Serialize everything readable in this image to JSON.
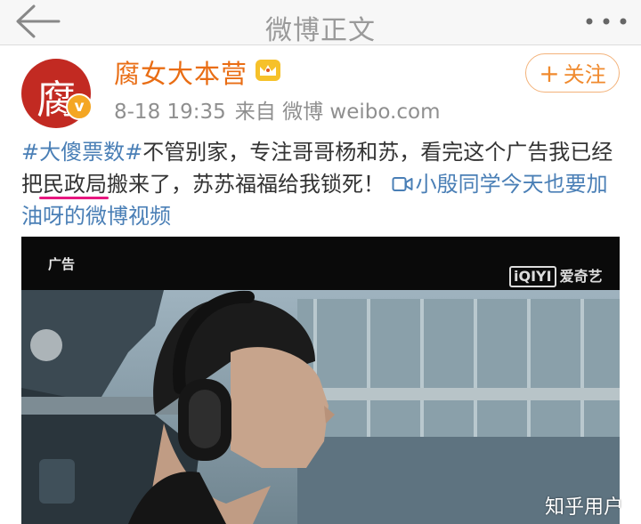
{
  "nav": {
    "title": "微博正文",
    "back_icon": "arrow-left-icon",
    "more_icon": "more-dots-icon"
  },
  "post": {
    "avatar_char": "腐",
    "verified_badge": "v",
    "username": "腐女大本营",
    "crown_icon": "crown-icon",
    "date": "8-18 19:35",
    "source": "来自 微博 weibo.com",
    "follow": "关注",
    "follow_plus": "+",
    "text": {
      "hashtag": "#大傻票数#",
      "part1": "不管别家，专注哥哥杨和苏，看完这个广告我已经把",
      "marked": "民政局",
      "part2": "搬来了，苏苏福福给我锁死！",
      "video_link": "小殷同学今天也要加油呀的微博视频"
    }
  },
  "video": {
    "ad_label": "广告",
    "brand_box": "iQIYI",
    "brand_text": "爱奇艺"
  },
  "watermark": "知乎用户",
  "colors": {
    "username": "#e96d14",
    "link": "#4a7fb6",
    "follow_border": "#f3b27a",
    "marker": "#e8177f",
    "avatar_bg": "#c22a22",
    "badge": "#f4a623"
  }
}
